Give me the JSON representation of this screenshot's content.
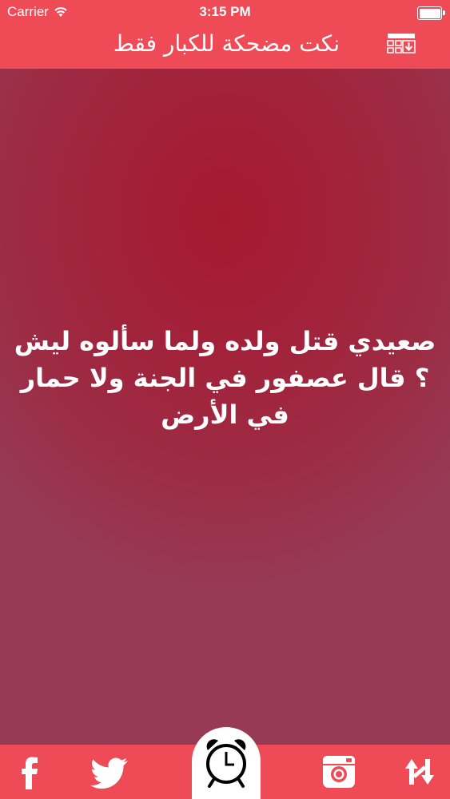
{
  "status_bar": {
    "carrier": "Carrier",
    "time": "3:15 PM",
    "wifi_icon": "wifi-icon",
    "battery_icon": "battery-icon"
  },
  "header": {
    "title": "نكت مضحكة للكبار فقط",
    "menu_icon": "list-download-icon"
  },
  "joke": {
    "text": "صعيدي قتل ولده ولما سألوه ليش ؟ قال عصفور في الجنة ولا حمار في الأرض"
  },
  "tabbar": {
    "items": [
      {
        "icon": "facebook-icon"
      },
      {
        "icon": "twitter-icon"
      },
      {
        "icon": "alarm-clock-icon"
      },
      {
        "icon": "instagram-icon"
      },
      {
        "icon": "shuffle-icon"
      }
    ]
  },
  "colors": {
    "header_bg": "#ee4b57",
    "content_bg": "#9b2a45",
    "text": "#ffffff"
  }
}
